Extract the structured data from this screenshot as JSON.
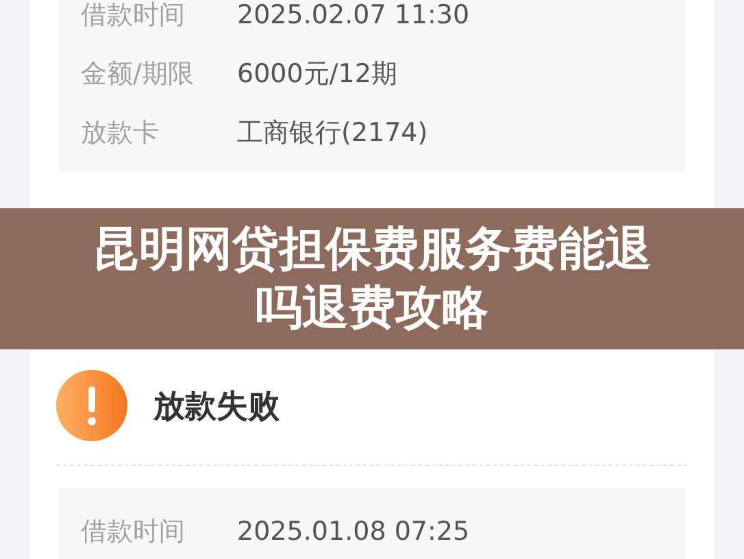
{
  "loan_card": {
    "details": [
      {
        "label": "借款时间",
        "value": "2025.02.07 11:30"
      },
      {
        "label": "金额/期限",
        "value": "6000元/12期"
      },
      {
        "label": "放款卡",
        "value": "工商银行(2174)"
      }
    ]
  },
  "banner": {
    "title": "昆明网贷担保费服务费能退吗退费攻略"
  },
  "status_card": {
    "kind": "warning",
    "status": "放款失败",
    "details": [
      {
        "label": "借款时间",
        "value": "2025.01.08 07:25"
      }
    ]
  }
}
